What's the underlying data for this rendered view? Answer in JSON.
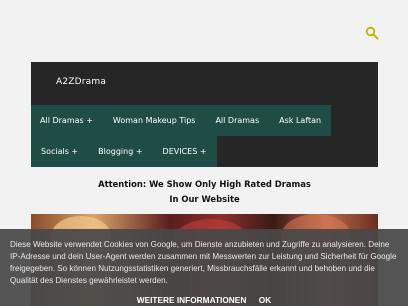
{
  "header": {
    "brand": "A2ZDrama",
    "search_icon": "search-icon",
    "accent_color": "#c6b400"
  },
  "menu": {
    "row1": [
      "All Dramas +",
      "Woman Makeup Tips",
      "All Dramas",
      "Ask Laftan"
    ],
    "row2": [
      "Socials +",
      "Blogging +",
      "DEVICES +"
    ],
    "background": "#1f4d45"
  },
  "attention": {
    "line1": "Attention: We Show Only High Rated Dramas",
    "line2": "In Our Website"
  },
  "cookie_notice": {
    "text": "Diese Website verwendet Cookies von Google, um Dienste anzubieten und Zugriffe zu analysieren. Deine IP-Adresse und dein User-Agent werden zusammen mit Messwerten zur Leistung und Sicherheit für Google freigegeben. So können Nutzungsstatistiken generiert, Missbrauchsfälle erkannt und behoben und die Qualität des Dienstes gewährleistet werden.",
    "more_info_label": "WEITERE INFORMATIONEN",
    "ok_label": "OK"
  }
}
